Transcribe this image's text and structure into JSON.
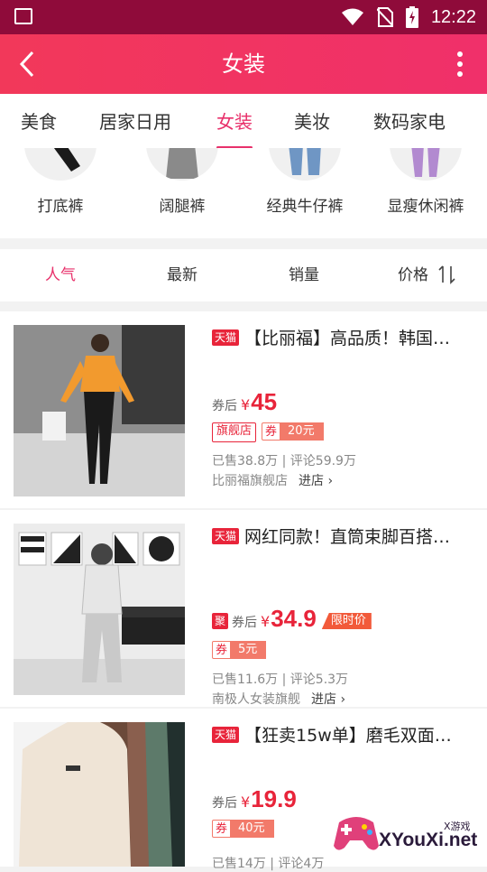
{
  "status_bar": {
    "time": "12:22"
  },
  "header": {
    "title": "女装"
  },
  "category_tabs": [
    {
      "label": "美食"
    },
    {
      "label": "居家日用"
    },
    {
      "label": "女装",
      "active": true
    },
    {
      "label": "美妆"
    },
    {
      "label": "数码家电"
    }
  ],
  "sub_categories": [
    {
      "label": "打底裤"
    },
    {
      "label": "阔腿裤"
    },
    {
      "label": "经典牛仔裤"
    },
    {
      "label": "显瘦休闲裤"
    }
  ],
  "sort_bar": {
    "popular": "人气",
    "newest": "最新",
    "sales": "销量",
    "price": "价格",
    "price_icon": "1l"
  },
  "products": [
    {
      "tag": "天猫",
      "title": "【比丽福】高品质！韩国…",
      "after_label": "券后",
      "currency": "¥",
      "price": "45",
      "shop_badge": "旗舰店",
      "coupon_label": "券",
      "coupon_amount": "20元",
      "sales": "已售38.8万 | 评论59.9万",
      "shop": "比丽福旗舰店",
      "enter": "进店"
    },
    {
      "tag": "天猫",
      "title": "网红同款！直筒束脚百搭…",
      "ju_tag": "聚",
      "after_label": "券后",
      "currency": "¥",
      "price": "34.9",
      "flash_label": "限时价",
      "coupon_label": "券",
      "coupon_amount": "5元",
      "sales": "已售11.6万 | 评论5.3万",
      "shop": "南极人女装旗舰",
      "enter": "进店"
    },
    {
      "tag": "天猫",
      "title": "【狂卖15w单】磨毛双面…",
      "after_label": "券后",
      "currency": "¥",
      "price": "19.9",
      "coupon_label": "券",
      "coupon_amount": "40元",
      "sales": "已售14万 | 评论4万"
    }
  ],
  "watermark": {
    "text": "XYouXi.net",
    "small": "X游戏"
  },
  "colors": {
    "accent": "#e8316b",
    "status_bar": "#8f0b3a",
    "header": "#f2385a",
    "price": "#e8243a"
  }
}
